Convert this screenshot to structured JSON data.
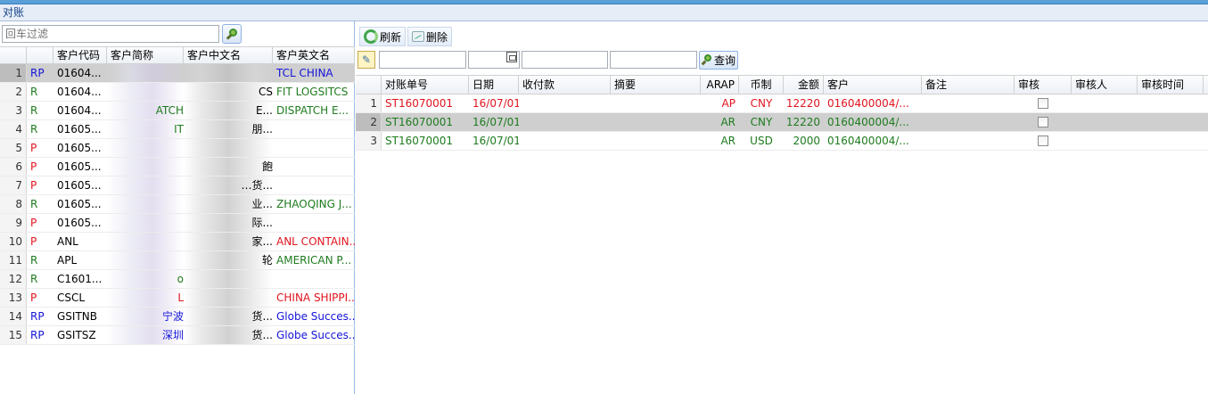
{
  "window": {
    "title": "对账"
  },
  "left": {
    "filter_placeholder": "回车过滤",
    "columns": [
      "客户代码",
      "客户简称",
      "客户中文名",
      "客户英文名"
    ],
    "rows": [
      {
        "n": "1",
        "type": "RP",
        "code": "01604...",
        "abbr": "",
        "cn": "",
        "en": "TCL CHINA"
      },
      {
        "n": "2",
        "type": "R",
        "code": "01604...",
        "abbr": "",
        "cn": "CS",
        "en": "FIT LOGSITCS"
      },
      {
        "n": "3",
        "type": "R",
        "code": "01604...",
        "abbr": "ATCH",
        "cn": "E...",
        "en": "DISPATCH E..."
      },
      {
        "n": "4",
        "type": "R",
        "code": "01605...",
        "abbr": "IT",
        "cn": "朋...",
        "en": ""
      },
      {
        "n": "5",
        "type": "P",
        "code": "01605...",
        "abbr": "",
        "cn": "",
        "en": ""
      },
      {
        "n": "6",
        "type": "P",
        "code": "01605...",
        "abbr": "",
        "cn": "飽",
        "en": ""
      },
      {
        "n": "7",
        "type": "P",
        "code": "01605...",
        "abbr": "",
        "cn": "…货...",
        "en": ""
      },
      {
        "n": "8",
        "type": "R",
        "code": "01605...",
        "abbr": "",
        "cn": "业...",
        "en": "ZHAOQING J..."
      },
      {
        "n": "9",
        "type": "P",
        "code": "01605...",
        "abbr": "",
        "cn": "际...",
        "en": ""
      },
      {
        "n": "10",
        "type": "P",
        "code": "ANL",
        "abbr": "",
        "cn": "家...",
        "en": "ANL CONTAIN..."
      },
      {
        "n": "11",
        "type": "R",
        "code": "APL",
        "abbr": "",
        "cn": "轮",
        "en": "AMERICAN P..."
      },
      {
        "n": "12",
        "type": "R",
        "code": "C1601...",
        "abbr": "o",
        "cn": "",
        "en": ""
      },
      {
        "n": "13",
        "type": "P",
        "code": "CSCL",
        "abbr": "L",
        "cn": "",
        "en": "CHINA SHIPPI..."
      },
      {
        "n": "14",
        "type": "RP",
        "code": "GSITNB",
        "abbr": "宁波",
        "cn": "货...",
        "en": "Globe Succes..."
      },
      {
        "n": "15",
        "type": "RP",
        "code": "GSITSZ",
        "abbr": "深圳",
        "cn": "货...",
        "en": "Globe Succes..."
      }
    ],
    "selected_index": 0
  },
  "right": {
    "toolbar": {
      "refresh": "刷新",
      "delete": "删除"
    },
    "query_label": "查询",
    "columns": [
      "对账单号",
      "日期",
      "收付款",
      "摘要",
      "ARAP",
      "币制",
      "金额",
      "客户",
      "备注",
      "审核",
      "审核人",
      "审核时间"
    ],
    "rows": [
      {
        "n": "1",
        "no": "ST16070001",
        "date": "16/07/01",
        "pay": "",
        "memo": "",
        "arap": "AP",
        "cur": "CNY",
        "amt": "12220",
        "cust": "0160400004/...",
        "remark": "",
        "checked": false,
        "by": "",
        "time": ""
      },
      {
        "n": "2",
        "no": "ST16070001",
        "date": "16/07/01",
        "pay": "",
        "memo": "",
        "arap": "AR",
        "cur": "CNY",
        "amt": "12220",
        "cust": "0160400004/...",
        "remark": "",
        "checked": false,
        "by": "",
        "time": ""
      },
      {
        "n": "3",
        "no": "ST16070001",
        "date": "16/07/01",
        "pay": "",
        "memo": "",
        "arap": "AR",
        "cur": "USD",
        "amt": "2000",
        "cust": "0160400004/...",
        "remark": "",
        "checked": false,
        "by": "",
        "time": ""
      }
    ],
    "selected_index": 1
  },
  "colors": {
    "R": "#1e7b1e",
    "P": "#e0141e",
    "RP": "#1414d8",
    "titlebar": "#e6edf6",
    "selected_row": "#cfcfcf"
  },
  "icons": {
    "search": "search-icon",
    "refresh": "refresh-icon",
    "delete": "delete-icon",
    "clear": "broom-icon",
    "calendar": "calendar-icon"
  }
}
